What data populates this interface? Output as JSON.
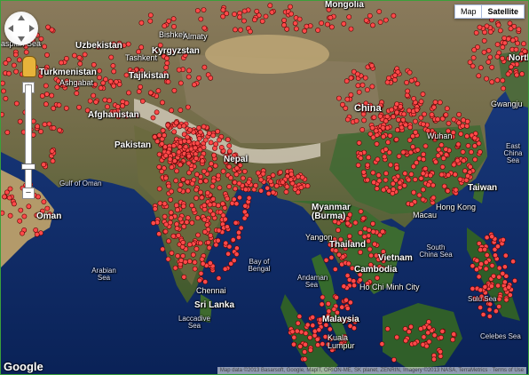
{
  "map_type": {
    "map_label": "Map",
    "satellite_label": "Satellite",
    "selected": "Satellite"
  },
  "controls": {
    "zoom_in": "+",
    "zoom_out": "−",
    "pan": "pan-control-icon",
    "pegman": "pegman-icon"
  },
  "logo": "Google",
  "attribution": "Map data ©2013 Basarsoft, Google, MapIT, ORION-ME, SK planet, ZENRIN, Imagery ©2013 NASA, TerraMetrics · Terms of Use",
  "labels": {
    "mongolia": "Mongolia",
    "uzbekistan": "Uzbekistan",
    "bishkek": "Bishkek",
    "almaty": "Almaty",
    "kyrgyzstan": "Kyrgyzstan",
    "tashkent": "Tashkent",
    "tajikistan": "Tajikistan",
    "turkmenistan": "Turkmenistan",
    "ashgabat": "Ashgabat",
    "afghanistan": "Afghanistan",
    "pakistan": "Pakistan",
    "nepal": "Nepal",
    "oman": "Oman",
    "gulf_of_oman": "Gulf of Oman",
    "oman_country": "Oman",
    "china": "China",
    "wuhan": "Wuhan",
    "north": "North",
    "gwangju": "Gwangju",
    "east_china_sea": "East China Sea",
    "taiwan": "Taiwan",
    "hong_kong": "Hong Kong",
    "macau": "Macau",
    "myanmar": "Myanmar (Burma)",
    "yangon": "Yangon",
    "thailand": "Thailand",
    "vietnam": "Vietnam",
    "cambodia": "Cambodia",
    "ho_chi_minh": "Ho Chi Minh City",
    "south_china_sea": "South China Sea",
    "sulu_sea": "Sulu Sea",
    "celebes_sea": "Celebes Sea",
    "malaysia": "Malaysia",
    "kuala_lumpur": "Kuala Lumpur",
    "arabian_sea": "Arabian Sea",
    "bay_of_bengal": "Bay of Bengal",
    "andaman_sea": "Andaman Sea",
    "chennai": "Chennai",
    "sri_lanka": "Sri Lanka",
    "laccadive_sea": "Laccadive Sea",
    "caspian_sea": "aspian Sea"
  },
  "marker_color": "#ff4a4a",
  "marker_count": 1400
}
